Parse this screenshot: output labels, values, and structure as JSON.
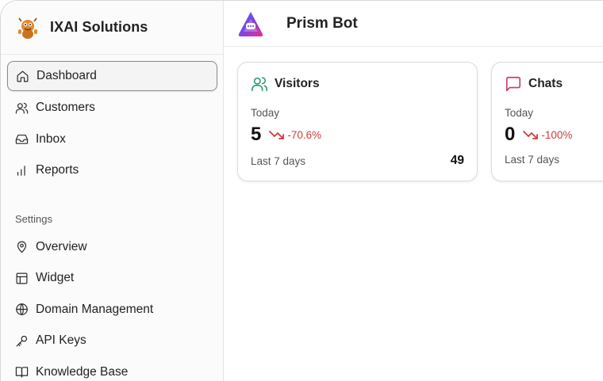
{
  "sidebar": {
    "brand_name": "IXAI Solutions",
    "items": [
      {
        "label": "Dashboard",
        "icon": "home-icon"
      },
      {
        "label": "Customers",
        "icon": "users-icon"
      },
      {
        "label": "Inbox",
        "icon": "inbox-icon"
      },
      {
        "label": "Reports",
        "icon": "bar-chart-icon"
      }
    ],
    "settings_label": "Settings",
    "settings_items": [
      {
        "label": "Overview",
        "icon": "map-pin-icon"
      },
      {
        "label": "Widget",
        "icon": "layout-icon"
      },
      {
        "label": "Domain Management",
        "icon": "globe-icon"
      },
      {
        "label": "API Keys",
        "icon": "key-icon"
      },
      {
        "label": "Knowledge Base",
        "icon": "book-icon"
      }
    ]
  },
  "header": {
    "bot_name": "Prism Bot"
  },
  "cards": [
    {
      "title": "Visitors",
      "icon": "users-icon",
      "icon_color": "#2f9e6e",
      "today_label": "Today",
      "today_value": "5",
      "change": "-70.6%",
      "week_label": "Last 7 days",
      "week_value": "49"
    },
    {
      "title": "Chats",
      "icon": "message-square-icon",
      "icon_color": "#d0356f",
      "today_label": "Today",
      "today_value": "0",
      "change": "-100%",
      "week_label": "Last 7 days",
      "week_value": ""
    }
  ],
  "colors": {
    "negative": "#d23b3b"
  }
}
